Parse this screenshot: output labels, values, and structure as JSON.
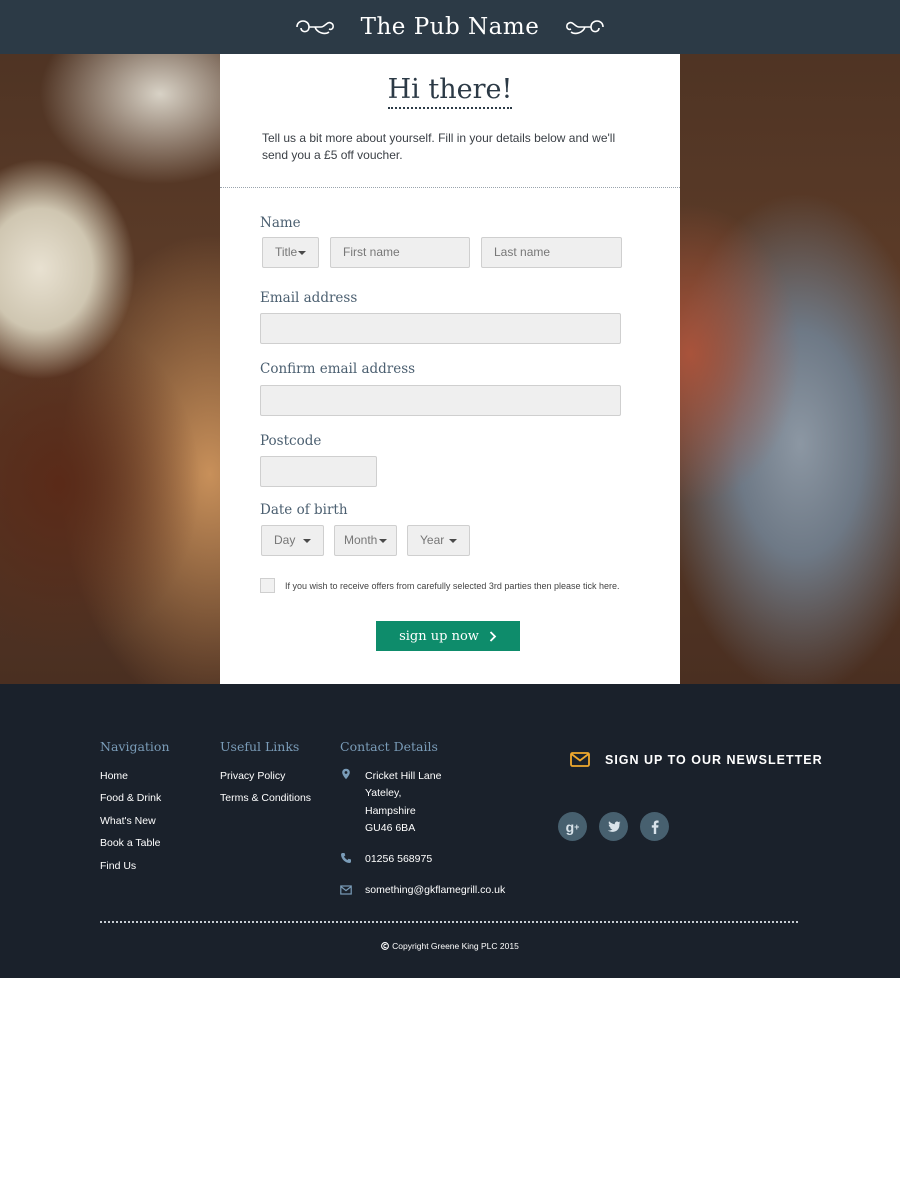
{
  "header": {
    "title": "The Pub Name"
  },
  "form": {
    "heading": "Hi there!",
    "intro": "Tell us a bit more about yourself. Fill in your details below and we'll send you a £5 off voucher.",
    "name_label": "Name",
    "title_select": "Title",
    "first_name_placeholder": "First name",
    "last_name_placeholder": "Last name",
    "email_label": "Email address",
    "confirm_email_label": "Confirm email address",
    "postcode_label": "Postcode",
    "dob_label": "Date of birth",
    "day_select": "Day",
    "month_select": "Month",
    "year_select": "Year",
    "consent_text": "If you wish to receive offers from carefully selected 3rd parties then please tick here.",
    "consent_checked": false,
    "submit_label": "sign up now",
    "submit_color": "#0e8c6b"
  },
  "footer": {
    "navigation": {
      "heading": "Navigation",
      "items": [
        "Home",
        "Food & Drink",
        "What's New",
        "Book a Table",
        "Find Us"
      ]
    },
    "useful_links": {
      "heading": "Useful Links",
      "items": [
        "Privacy Policy",
        "Terms & Conditions"
      ]
    },
    "contact": {
      "heading": "Contact Details",
      "address": [
        "Cricket Hill Lane",
        "Yateley,",
        "Hampshire",
        "GU46 6BA"
      ],
      "phone": "01256 568975",
      "email": "something@gkflamegrill.co.uk"
    },
    "newsletter_label": "SIGN UP TO OUR NEWSLETTER",
    "social_icons": [
      "google-plus-icon",
      "twitter-icon",
      "facebook-icon"
    ],
    "copyright": "Copyright Greene King PLC 2015"
  },
  "colors": {
    "header_bg": "#2c3a46",
    "footer_bg": "#1a212b",
    "accent_heading": "#7a9cb8",
    "newsletter_icon": "#f0a92e"
  }
}
